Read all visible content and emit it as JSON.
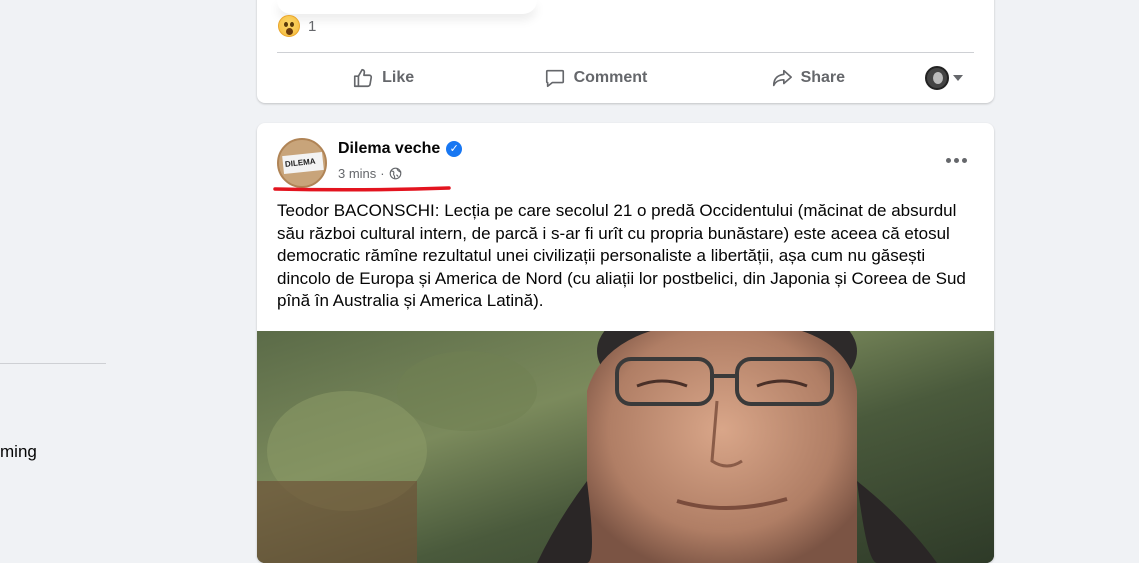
{
  "left_panel": {
    "partial_text": "ming"
  },
  "previous_post": {
    "reaction_count": "1",
    "actions": {
      "like": "Like",
      "comment": "Comment",
      "share": "Share"
    }
  },
  "post": {
    "page_name": "Dilema veche",
    "avatar_logo_text": "DILEMA",
    "timestamp": "3 mins",
    "separator": "·",
    "text": "Teodor BACONSCHI: Lecția pe care secolul 21 o predă Occidentului (măcinat de absurdul său război cultural intern, de parcă i s-ar fi urît cu propria bunăstare) este aceea că etosul democratic rămîne rezultatul unei civilizații personaliste a libertății, așa cum nu găsești dincolo de Europa și America de Nord (cu aliații lor postbelici, din Japonia și Coreea de Sud pînă în Australia și America Latină)."
  },
  "colors": {
    "accent": "#1877f2",
    "secondary_text": "#65676b",
    "annotation_red": "#e3141f"
  }
}
